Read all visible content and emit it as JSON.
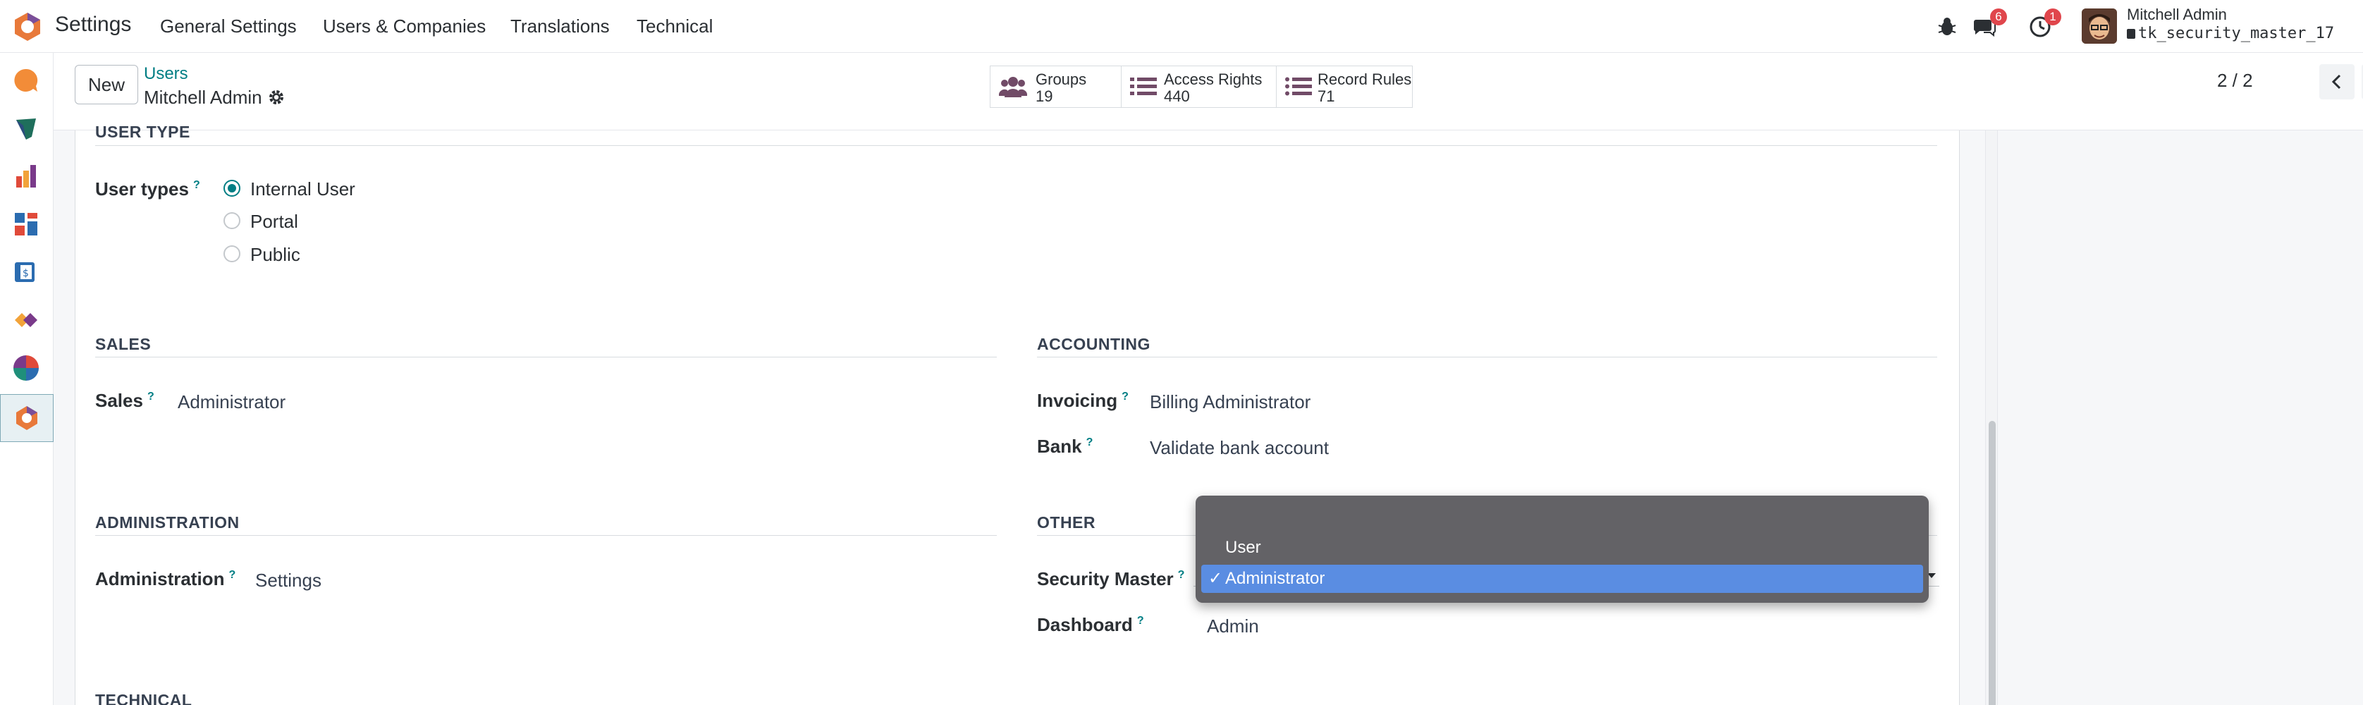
{
  "app": {
    "title": "Settings"
  },
  "menu": [
    {
      "label": "General Settings"
    },
    {
      "label": "Users & Companies"
    },
    {
      "label": "Translations"
    },
    {
      "label": "Technical"
    }
  ],
  "systray": {
    "messages_count": "6",
    "activities_count": "1",
    "user_name": "Mitchell Admin",
    "database": "tk_security_master_17"
  },
  "control": {
    "new_label": "New",
    "breadcrumb": "Users",
    "record_name": "Mitchell Admin",
    "smart_buttons": [
      {
        "label": "Groups",
        "value": "19"
      },
      {
        "label": "Access Rights",
        "value": "440"
      },
      {
        "label": "Record Rules",
        "value": "71"
      }
    ],
    "pager": "2 / 2"
  },
  "form": {
    "user_type_section": "USER TYPE",
    "user_types_label": "User types",
    "user_type_options": [
      "Internal User",
      "Portal",
      "Public"
    ],
    "sales_section": "SALES",
    "sales_label": "Sales",
    "sales_value": "Administrator",
    "accounting_section": "ACCOUNTING",
    "invoicing_label": "Invoicing",
    "invoicing_value": "Billing Administrator",
    "bank_label": "Bank",
    "bank_value": "Validate bank account",
    "administration_section": "ADMINISTRATION",
    "administration_label": "Administration",
    "administration_value": "Settings",
    "other_section": "OTHER",
    "security_master_label": "Security Master",
    "dashboard_label": "Dashboard",
    "dashboard_value": "Admin",
    "technical_section": "TECHNICAL",
    "help_mark": "?"
  },
  "dropdown": {
    "options": [
      "User",
      "Administrator"
    ],
    "selected": "Administrator",
    "check": "✓"
  },
  "colors": {
    "accent": "#017e84",
    "dropdown_bg": "#636266",
    "dropdown_selected": "#5a8de2",
    "badge": "#e0464c"
  }
}
